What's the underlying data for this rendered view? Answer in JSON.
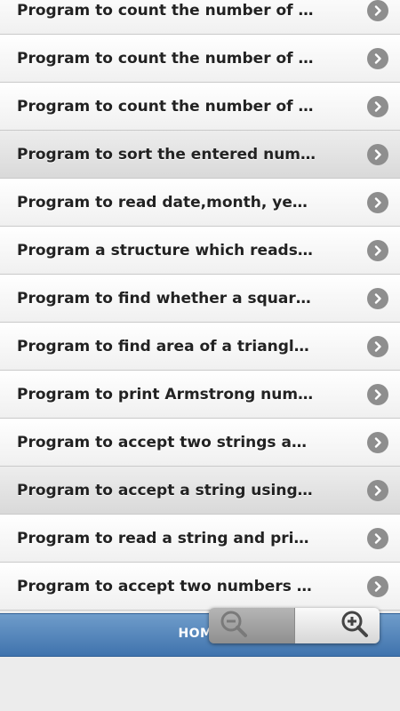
{
  "list": {
    "items": [
      {
        "label": "Program to count the number of words",
        "highlighted": false
      },
      {
        "label": "Program to count the number of wo...",
        "highlighted": false
      },
      {
        "label": "Program to count the number of wo...",
        "highlighted": false
      },
      {
        "label": "Program to sort the entered number...",
        "highlighted": true
      },
      {
        "label": "Program to read date,month, year a...",
        "highlighted": false
      },
      {
        "label": "Program a structure which reads ‘n’...",
        "highlighted": false
      },
      {
        "label": "Program to find whether a square m...",
        "highlighted": false
      },
      {
        "label": "Program to find area of a triangle w...",
        "highlighted": false
      },
      {
        "label": "Program to print Armstrong number...",
        "highlighted": false
      },
      {
        "label": "Program to accept two strings and ...",
        "highlighted": false
      },
      {
        "label": "Program to accept a string using po...",
        "highlighted": true
      },
      {
        "label": "Program to read a string and print t...",
        "highlighted": false
      },
      {
        "label": "Program to accept two numbers an...",
        "highlighted": false
      }
    ],
    "chevron_icon": "chevron-right-circle-icon"
  },
  "footer": {
    "home_label": "HOME"
  },
  "zoom": {
    "zoom_out_icon": "zoom-out-icon",
    "zoom_in_icon": "zoom-in-icon"
  }
}
